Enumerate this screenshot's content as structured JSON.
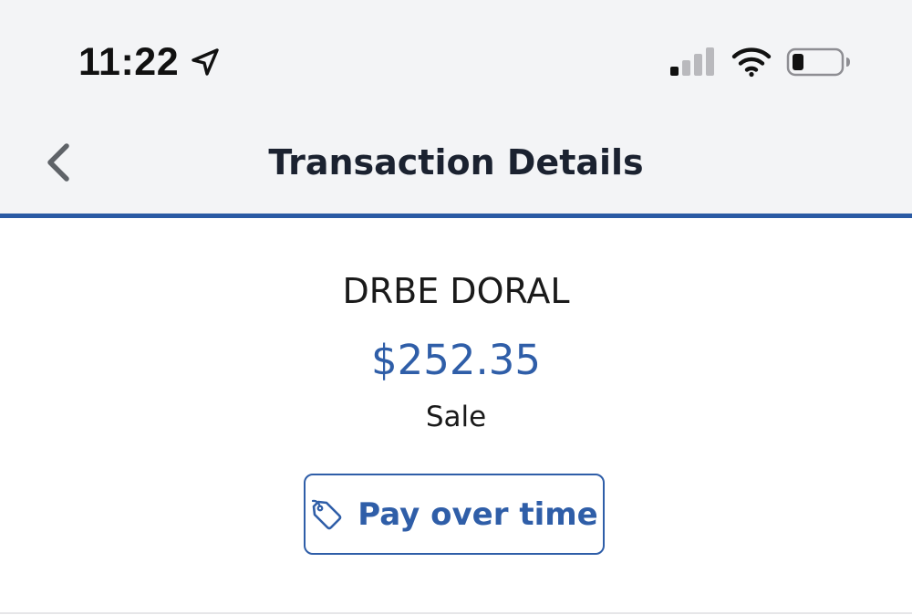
{
  "status_bar": {
    "time": "11:22",
    "icons": [
      "location-arrow-icon",
      "cellular-signal-icon",
      "wifi-icon",
      "battery-icon"
    ],
    "signal_bars_active": 1,
    "signal_bars_total": 4,
    "battery_level": 0.2
  },
  "nav": {
    "back_icon": "chevron-left-icon",
    "title": "Transaction Details"
  },
  "transaction": {
    "merchant": "DRBE DORAL",
    "amount": "$252.35",
    "type": "Sale"
  },
  "actions": {
    "pay_over_time_icon": "tag-icon",
    "pay_over_time_label": "Pay over time"
  },
  "colors": {
    "accent": "#2f5ea8",
    "header_background": "#f3f4f6",
    "divider": "#2a5aa4"
  }
}
